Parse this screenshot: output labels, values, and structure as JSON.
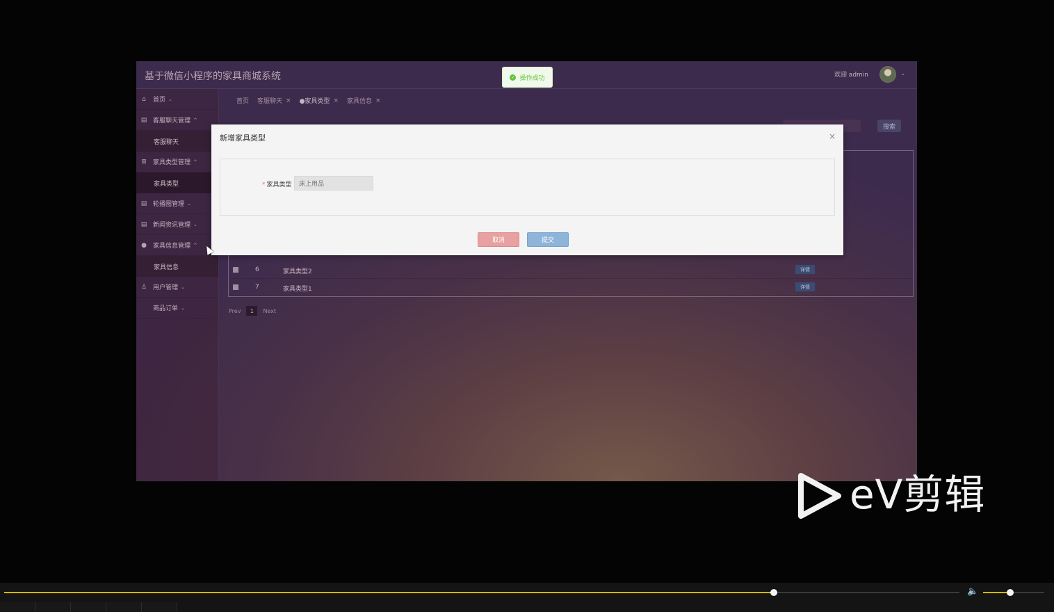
{
  "app": {
    "title": "基于微信小程序的家具商城系统",
    "welcome": "欢迎 admin",
    "caret": "⌄"
  },
  "sidebar": {
    "items": [
      {
        "icon": "home-icon",
        "label": "首页",
        "caret": "⌄"
      },
      {
        "icon": "list-icon",
        "label": "客服聊天管理",
        "caret": "^",
        "sub": "客服聊天"
      },
      {
        "icon": "plus-square-icon",
        "label": "家具类型管理",
        "caret": "^",
        "sub": "家具类型"
      },
      {
        "icon": "list-icon",
        "label": "轮播图管理",
        "caret": "⌄"
      },
      {
        "icon": "list-icon",
        "label": "新闻资讯管理",
        "caret": "⌄"
      },
      {
        "icon": "circle-icon",
        "label": "家具信息管理",
        "caret": "^",
        "sub": "家具信息"
      },
      {
        "icon": "user-icon",
        "label": "用户管理",
        "caret": "⌄"
      },
      {
        "icon": "",
        "label": "商品订单",
        "caret": "⌄"
      }
    ]
  },
  "tabs": [
    {
      "label": "首页",
      "closable": false
    },
    {
      "label": "客服聊天",
      "closable": true
    },
    {
      "label": "●家具类型",
      "closable": true
    },
    {
      "label": "家具信息",
      "closable": true
    }
  ],
  "toolbar": {
    "search_label": "搜索"
  },
  "table": {
    "rows": [
      {
        "index": "6",
        "name": "家具类型2",
        "action": "详情"
      },
      {
        "index": "7",
        "name": "家具类型1",
        "action": "详情"
      }
    ]
  },
  "pager": {
    "prev": "Prev",
    "page": "1",
    "next": "Next"
  },
  "toast": {
    "message": "操作成功",
    "icon": "check-circle-icon",
    "color": "#67c23a"
  },
  "modal": {
    "title": "新增家具类型",
    "close": "×",
    "field_required": "*",
    "field_label": "家具类型",
    "field_value": "床上用品",
    "cancel_label": "取消",
    "submit_label": "提交"
  },
  "watermark": {
    "text": "eV剪辑"
  },
  "player": {
    "progress": 0.806,
    "volume": 0.44,
    "accent_color": "#d8b800"
  }
}
